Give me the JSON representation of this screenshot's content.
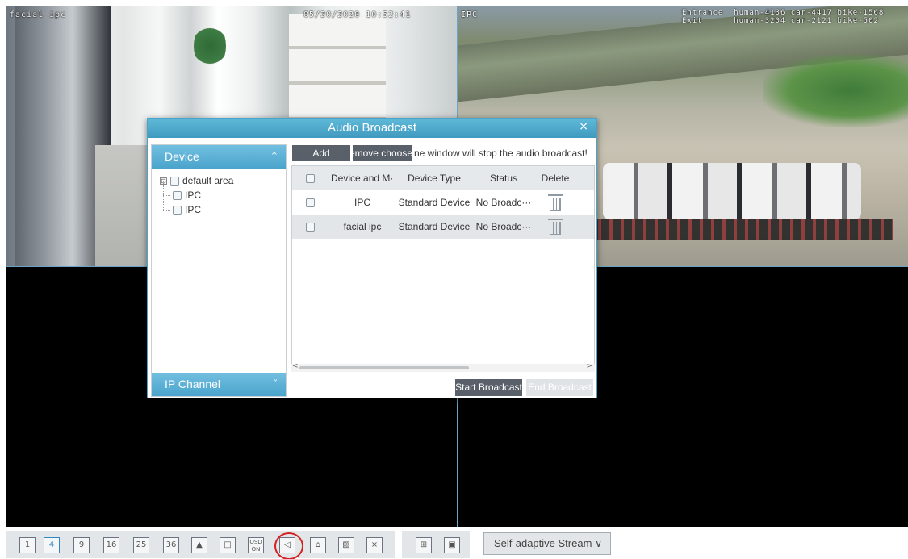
{
  "cameras": [
    {
      "name": "facial ipc",
      "timestamp": "05/20/2020 10:52:41"
    },
    {
      "name": "IPC",
      "overlay_line1": "Entrance  human-4136 car-4417 bike-1568",
      "overlay_line2": "Exit      human-3204 car-2121 bike-502"
    }
  ],
  "dialog": {
    "title": "Audio Broadcast",
    "close_icon": "×",
    "device_panel_label": "Device",
    "device_panel_chevron": "^",
    "ip_channel_label": "IP Channel",
    "ip_channel_chevron": "˅",
    "tree": {
      "root_label": "default area",
      "expander": "⊟",
      "children": [
        "IPC",
        "IPC"
      ]
    },
    "add_label": "Add",
    "remove_label": "remove choose",
    "notice": "ne window will stop the audio broadcast!",
    "table": {
      "headers": [
        "Device and M···",
        "Device Type",
        "Status",
        "Delete"
      ],
      "rows": [
        {
          "name": "IPC",
          "type": "Standard Device",
          "status": "No Broadc···"
        },
        {
          "name": "facial ipc",
          "type": "Standard Device",
          "status": "No Broadc···"
        }
      ]
    },
    "scroll_left": "<",
    "scroll_right": ">",
    "start_label": "Start Broadcast",
    "end_label": "End Broadcast"
  },
  "toolbar": {
    "layout_buttons": [
      "1",
      "4",
      "9",
      "16",
      "25",
      "36"
    ],
    "osd_top": "OSD",
    "osd_bottom": "ON",
    "stream_label": "Self-adaptive Stream",
    "stream_arrow": "∨"
  }
}
